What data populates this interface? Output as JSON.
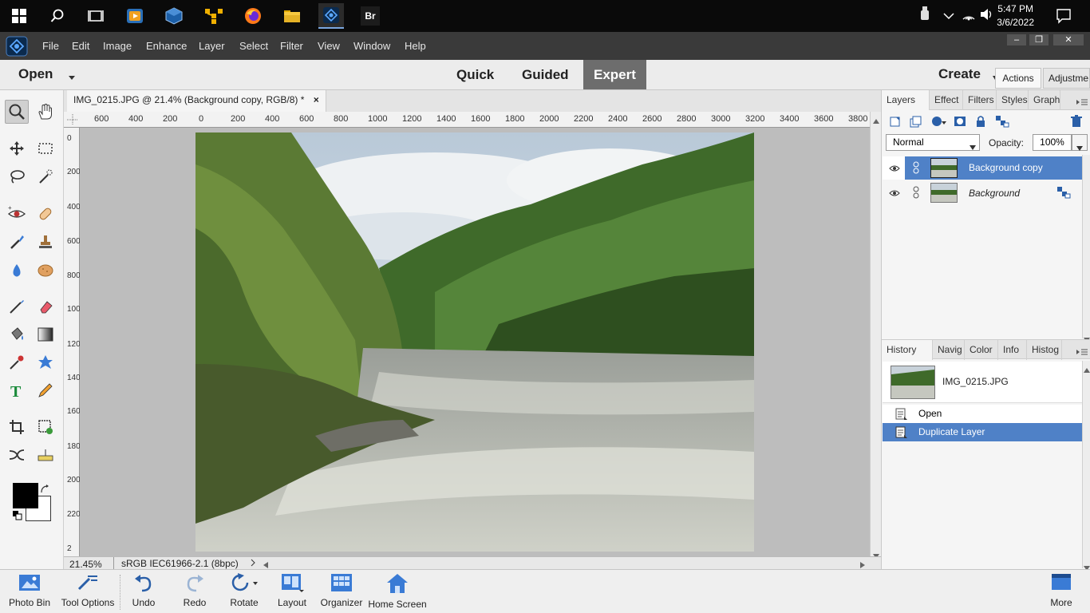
{
  "taskbar": {
    "time": "5:47 PM",
    "date": "3/6/2022",
    "apps": [
      "windows-start",
      "search",
      "task-view",
      "media-player",
      "virtualbox",
      "app-yellow",
      "firefox",
      "file-explorer",
      "photoshop-elements",
      "bridge"
    ],
    "bridge_label": "Br"
  },
  "menubar": {
    "items": [
      "File",
      "Edit",
      "Image",
      "Enhance",
      "Layer",
      "Select",
      "Filter",
      "View",
      "Window",
      "Help"
    ],
    "window_controls": [
      "–",
      "❐",
      "✕"
    ]
  },
  "modebar": {
    "open_label": "Open",
    "modes": [
      "Quick",
      "Guided",
      "Expert"
    ],
    "active_mode": "Expert",
    "create_label": "Create",
    "right_tabs": [
      "Actions",
      "Adjustme"
    ]
  },
  "document": {
    "tab_title": "IMG_0215.JPG @ 21.4% (Background copy, RGB/8) *",
    "close": "×",
    "zoom": "21.45%",
    "profile": "sRGB IEC61966-2.1 (8bpc)"
  },
  "rulers": {
    "horizontal": [
      "600",
      "400",
      "200",
      "0",
      "200",
      "400",
      "600",
      "800",
      "1000",
      "1200",
      "1400",
      "1600",
      "1800",
      "2000",
      "2200",
      "2400",
      "2600",
      "2800",
      "3000",
      "3200",
      "3400",
      "3600",
      "3800"
    ],
    "vertical": [
      "0",
      "200",
      "400",
      "600",
      "800",
      "1000",
      "1200",
      "1400",
      "1600",
      "1800",
      "2000",
      "2200",
      "2"
    ]
  },
  "layers_panel": {
    "tabs": [
      "Layers",
      "Effect",
      "Filters",
      "Styles",
      "Graph"
    ],
    "blend_mode": "Normal",
    "opacity_label": "Opacity:",
    "opacity_value": "100%",
    "layers": [
      {
        "name": "Background copy",
        "selected": true
      },
      {
        "name": "Background",
        "selected": false
      }
    ]
  },
  "history_panel": {
    "tabs": [
      "History",
      "Navig",
      "Color",
      "Info",
      "Histog"
    ],
    "snapshot": "IMG_0215.JPG",
    "steps": [
      {
        "label": "Open",
        "selected": false
      },
      {
        "label": "Duplicate Layer",
        "selected": true
      }
    ]
  },
  "bottombar": {
    "items": [
      "Photo Bin",
      "Tool Options",
      "Undo",
      "Redo",
      "Rotate",
      "Layout",
      "Organizer",
      "Home Screen"
    ],
    "more": "More"
  },
  "colors": {
    "accent": "#5b8fd6",
    "selected_row": "#4f81c7",
    "canvas_bg": "#bdbdbd"
  }
}
